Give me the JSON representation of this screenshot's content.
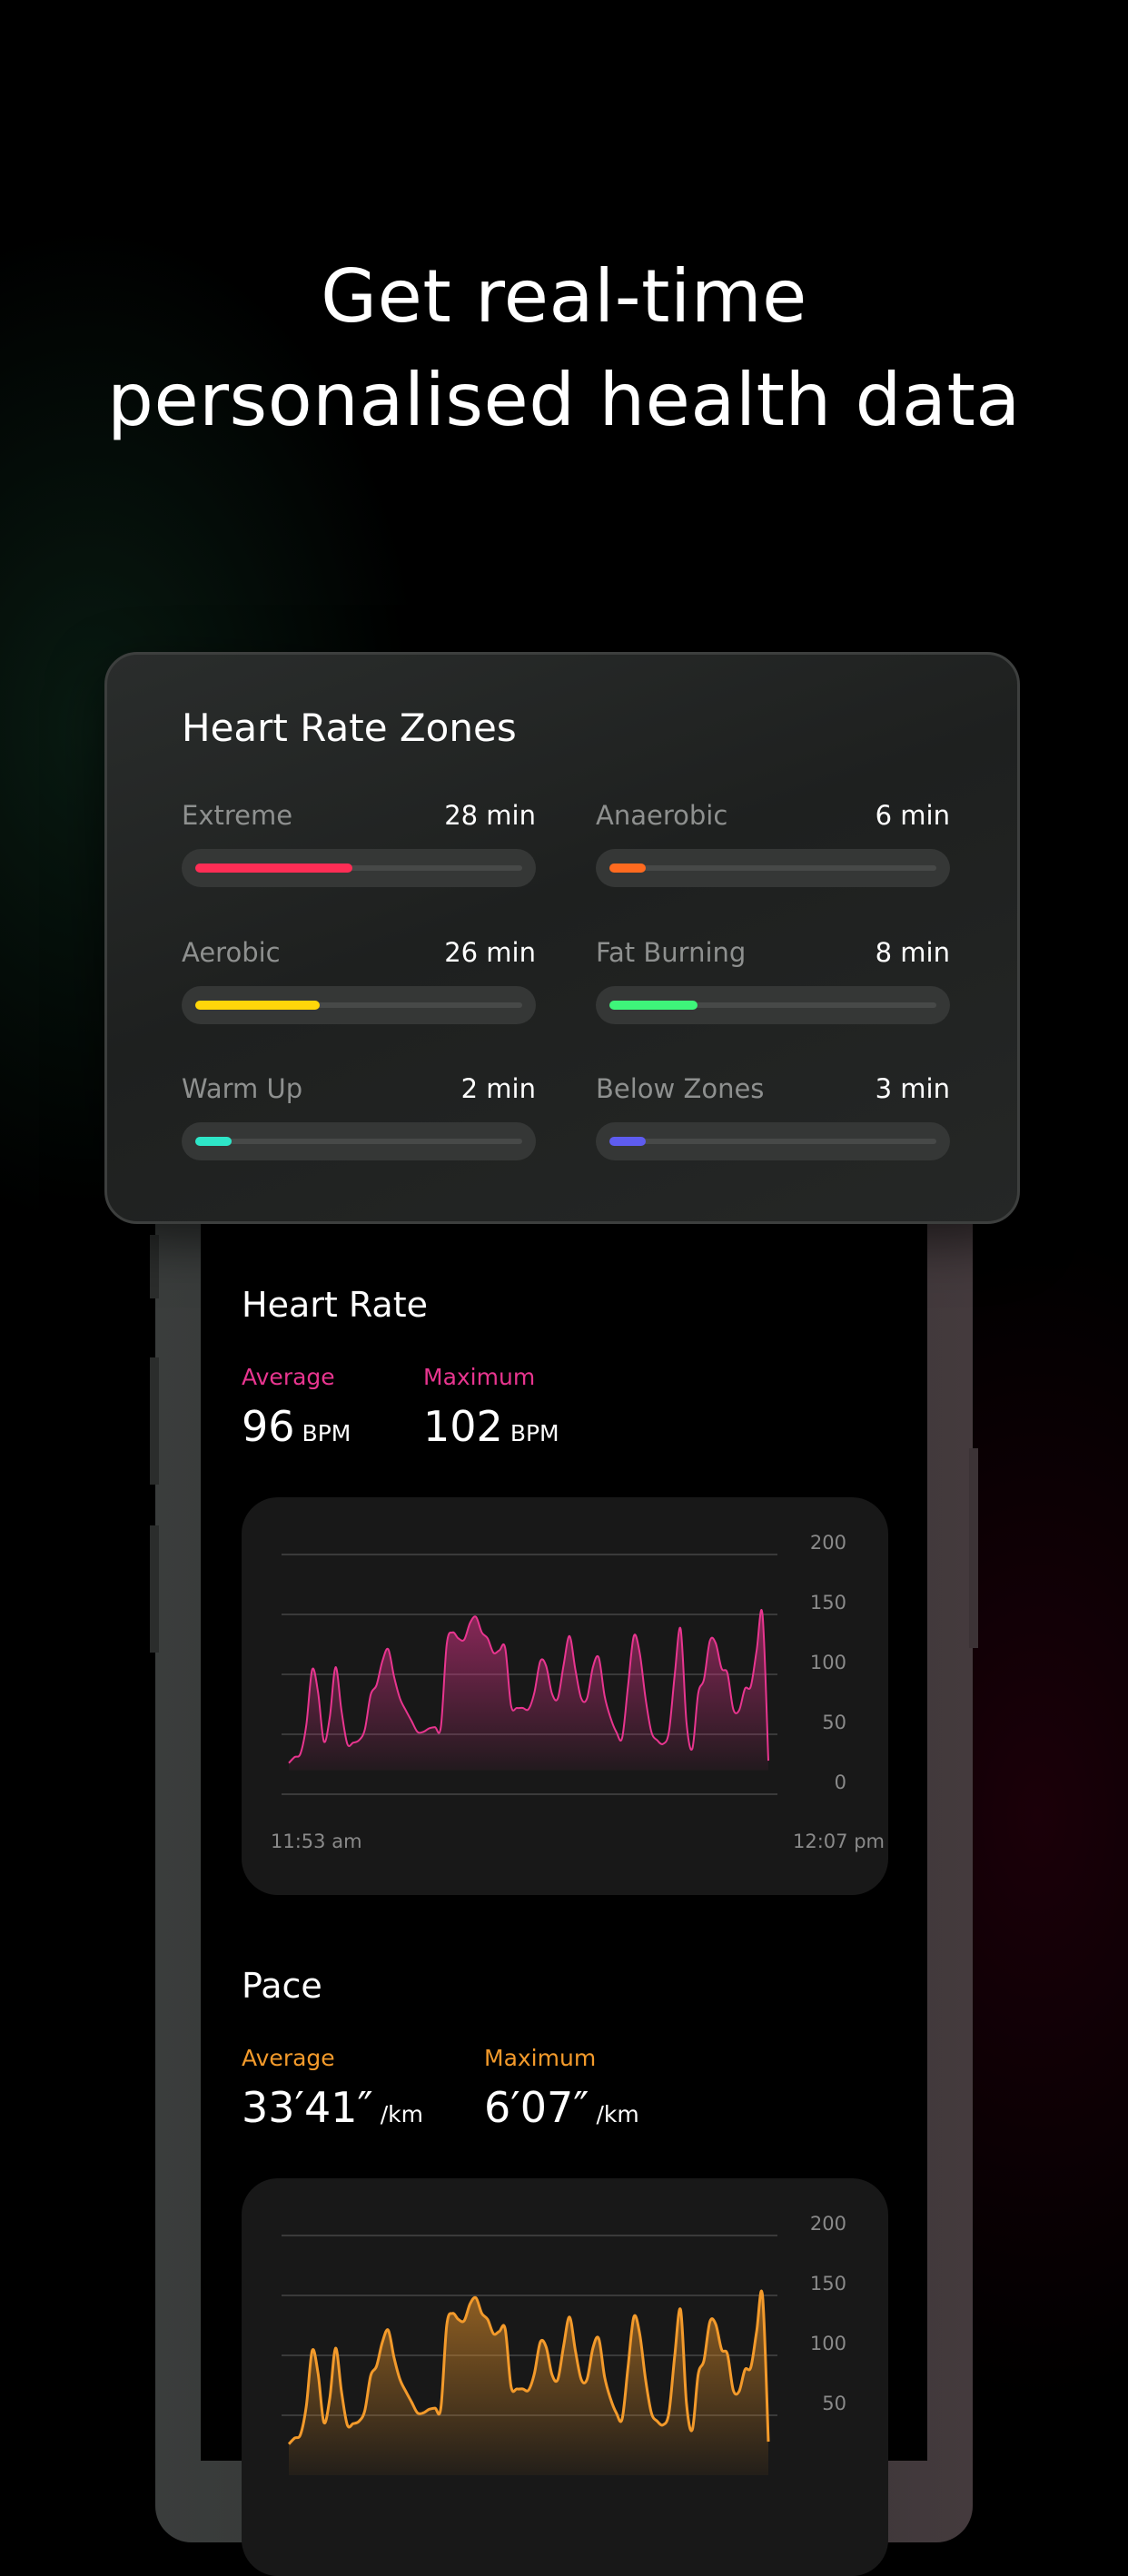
{
  "headline": {
    "line1": "Get real-time",
    "line2": "personalised health data"
  },
  "zones_card": {
    "title": "Heart Rate Zones",
    "zones": [
      {
        "label": "Extreme",
        "value": "28 min",
        "fill_fraction": 0.48,
        "color": "#ff2d55"
      },
      {
        "label": "Anaerobic",
        "value": "6 min",
        "fill_fraction": 0.11,
        "color": "#ff6a1f"
      },
      {
        "label": "Aerobic",
        "value": "26 min",
        "fill_fraction": 0.38,
        "color": "#ffd60a"
      },
      {
        "label": "Fat Burning",
        "value": "8 min",
        "fill_fraction": 0.27,
        "color": "#3ef57a"
      },
      {
        "label": "Warm Up",
        "value": "2 min",
        "fill_fraction": 0.11,
        "color": "#2ee6c8"
      },
      {
        "label": "Below Zones",
        "value": "3 min",
        "fill_fraction": 0.11,
        "color": "#5e5cf0"
      }
    ]
  },
  "heart_rate": {
    "title": "Heart Rate",
    "accent": "#e8358f",
    "average_label": "Average",
    "average_value": "96",
    "average_unit": "BPM",
    "maximum_label": "Maximum",
    "maximum_value": "102",
    "maximum_unit": "BPM"
  },
  "pace": {
    "title": "Pace",
    "accent": "#f39a2b",
    "average_label": "Average",
    "average_value": "33′41″",
    "average_unit": "/km",
    "maximum_label": "Maximum",
    "maximum_value": "6′07″",
    "maximum_unit": "/km"
  },
  "chart_data": [
    {
      "type": "area",
      "title": "Heart Rate",
      "color": "#e8358f",
      "xlabel": "",
      "ylabel": "",
      "x_start_label": "11:53 am",
      "x_end_label": "12:07 pm",
      "yticks": [
        200,
        150,
        100,
        50,
        0
      ],
      "ylim": [
        0,
        200
      ],
      "grid": true,
      "y_axis_side": "right",
      "values": [
        26,
        31,
        34,
        58,
        104,
        85,
        44,
        64,
        106,
        70,
        42,
        43,
        45,
        54,
        83,
        91,
        111,
        121,
        98,
        80,
        70,
        61,
        52,
        52,
        55,
        56,
        56,
        125,
        135,
        130,
        129,
        143,
        148,
        135,
        130,
        118,
        120,
        122,
        74,
        72,
        72,
        71,
        85,
        111,
        107,
        84,
        80,
        108,
        132,
        104,
        80,
        80,
        106,
        114,
        82,
        64,
        52,
        47,
        90,
        132,
        118,
        80,
        52,
        45,
        42,
        52,
        100,
        138,
        60,
        38,
        84,
        96,
        128,
        126,
        105,
        101,
        71,
        70,
        88,
        90,
        120,
        150,
        28
      ]
    },
    {
      "type": "area",
      "title": "Pace",
      "color": "#f39a2b",
      "xlabel": "",
      "ylabel": "",
      "yticks": [
        200,
        150,
        100,
        50
      ],
      "ylim": [
        0,
        200
      ],
      "grid": true,
      "y_axis_side": "right",
      "values": [
        26,
        31,
        34,
        58,
        104,
        85,
        44,
        64,
        106,
        70,
        42,
        43,
        45,
        54,
        83,
        91,
        111,
        121,
        98,
        80,
        70,
        61,
        52,
        52,
        55,
        56,
        56,
        125,
        135,
        130,
        129,
        143,
        148,
        135,
        130,
        118,
        120,
        122,
        74,
        72,
        72,
        71,
        85,
        111,
        107,
        84,
        80,
        108,
        132,
        104,
        80,
        80,
        106,
        114,
        82,
        64,
        52,
        47,
        90,
        132,
        118,
        80,
        52,
        45,
        42,
        52,
        100,
        138,
        60,
        38,
        84,
        96,
        128,
        126,
        105,
        101,
        71,
        70,
        88,
        90,
        120,
        150,
        28
      ]
    }
  ]
}
